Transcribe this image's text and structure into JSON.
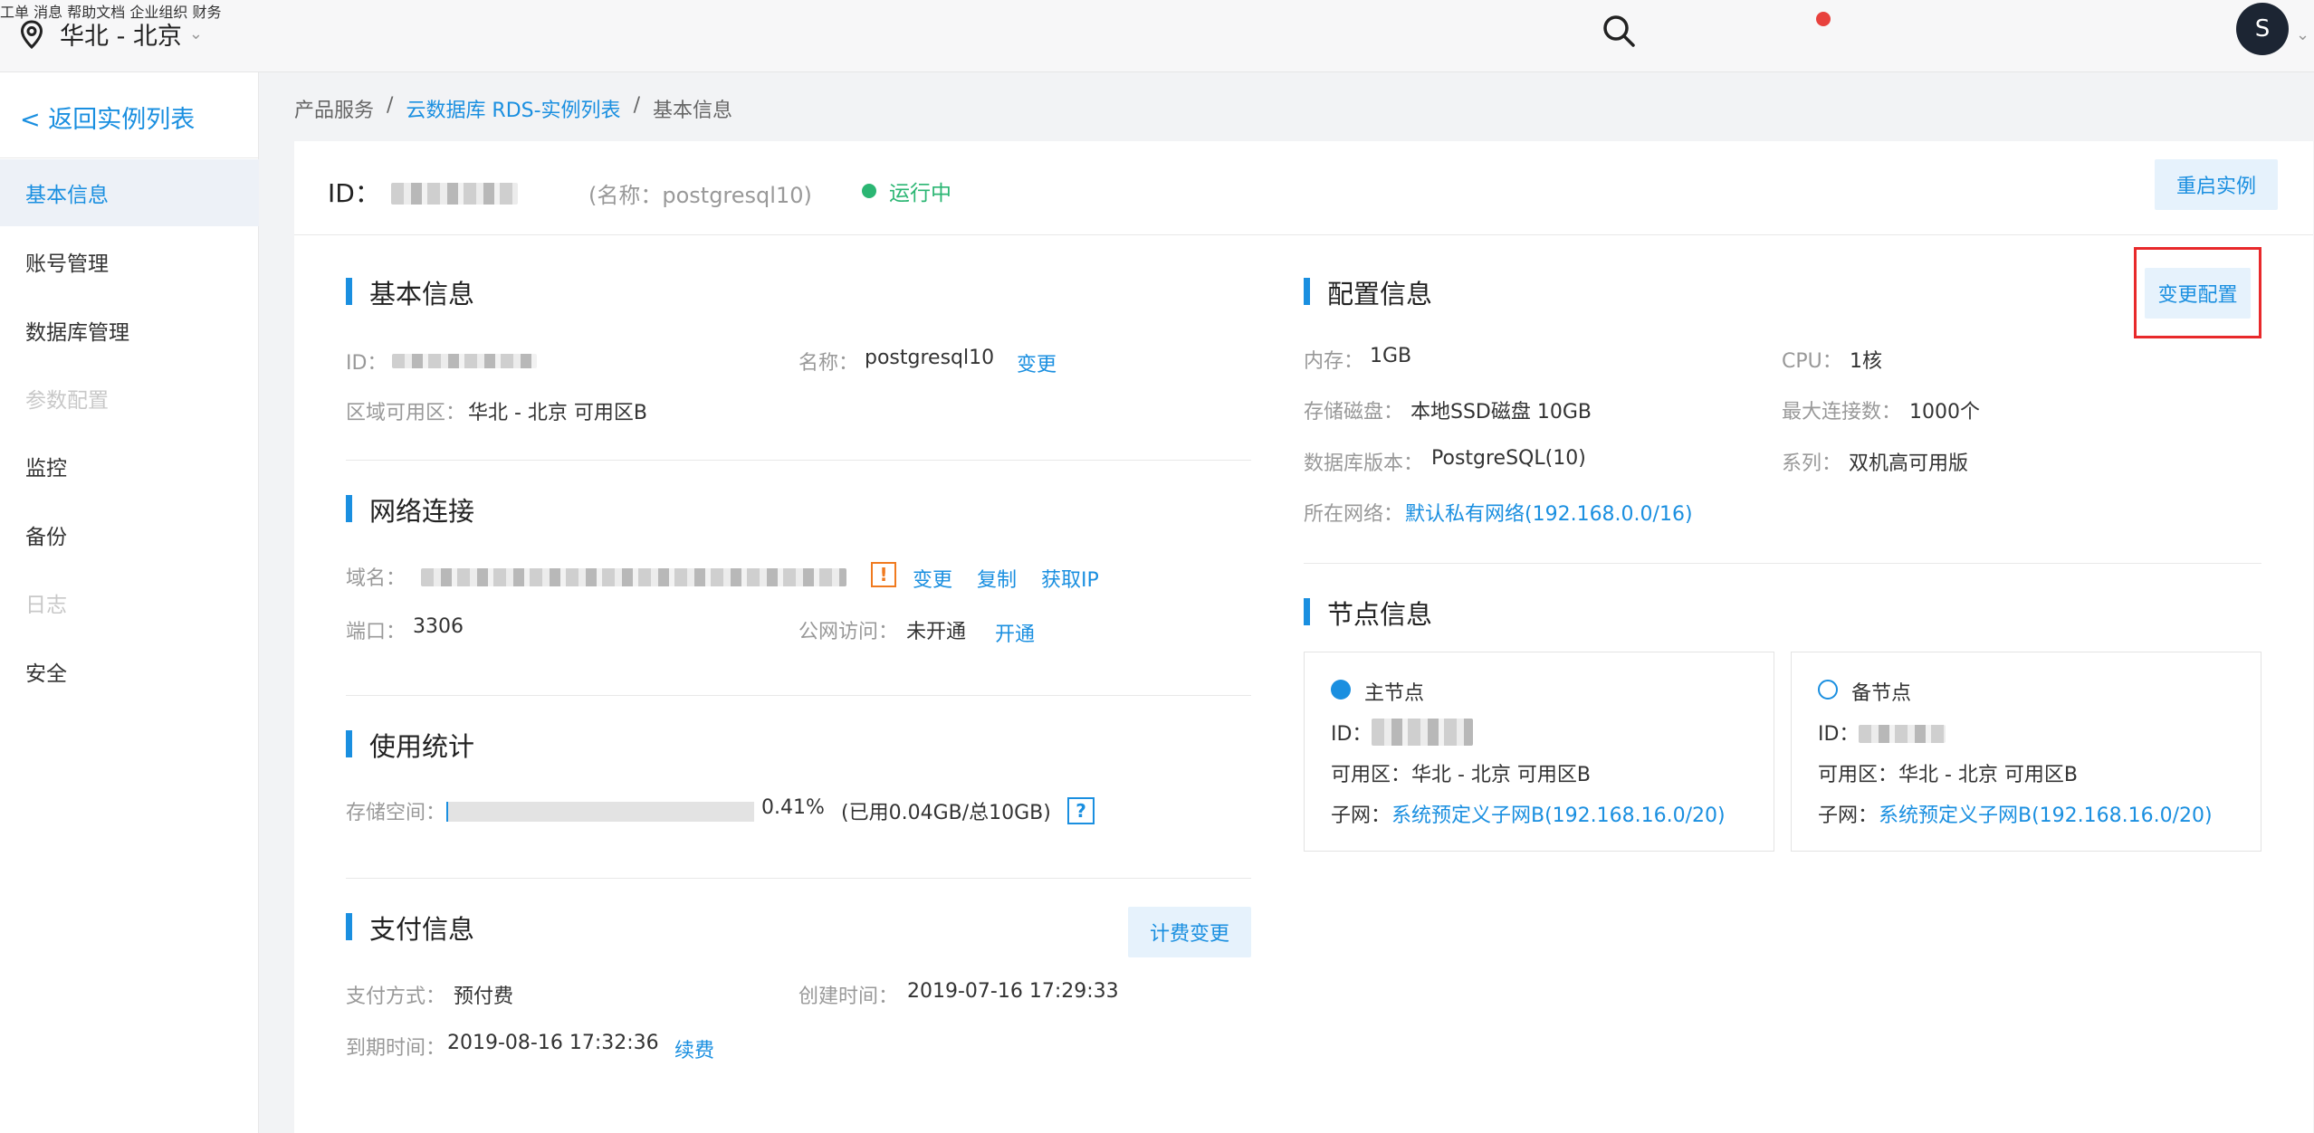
{
  "topbar": {
    "region": "华北 - 北京",
    "nav": {
      "ticket": "工单",
      "messages": "消息",
      "help": "帮助文档",
      "org": "企业组织",
      "finance": "财务"
    },
    "avatar": "S"
  },
  "sidebar": {
    "back": "< 返回实例列表",
    "items": [
      {
        "label": "基本信息"
      },
      {
        "label": "账号管理"
      },
      {
        "label": "数据库管理"
      },
      {
        "label": "参数配置"
      },
      {
        "label": "监控"
      },
      {
        "label": "备份"
      },
      {
        "label": "日志"
      },
      {
        "label": "安全"
      }
    ]
  },
  "breadcrumb": {
    "root": "产品服务",
    "sep": "/",
    "list": "云数据库 RDS-实例列表",
    "current": "基本信息"
  },
  "instance": {
    "id_label": "ID：",
    "name_hint": "(名称：postgresql10)",
    "status": "运行中",
    "restart": "重启实例"
  },
  "basic": {
    "title": "基本信息",
    "id_label": "ID：",
    "name_label": "名称：",
    "name_value": "postgresql10",
    "change": "变更",
    "zone_label": "区域可用区：",
    "zone_value": "华北 - 北京 可用区B"
  },
  "network": {
    "title": "网络连接",
    "domain_label": "域名：",
    "warn": "!",
    "change": "变更",
    "copy": "复制",
    "get_ip": "获取IP",
    "port_label": "端口：",
    "port_value": "3306",
    "public_label": "公网访问：",
    "public_value": "未开通",
    "open": "开通"
  },
  "usage": {
    "title": "使用统计",
    "storage_label": "存储空间：",
    "percent": "0.41%",
    "detail": "(已用0.04GB/总10GB)",
    "help": "?",
    "fraction": 0.0041
  },
  "payment": {
    "title": "支付信息",
    "change_billing": "计费变更",
    "method_label": "支付方式：",
    "method_value": "预付费",
    "created_label": "创建时间：",
    "created_value": "2019-07-16 17:29:33",
    "expire_label": "到期时间：",
    "expire_value": "2019-08-16 17:32:36",
    "renew": "续费"
  },
  "config": {
    "title": "配置信息",
    "change_config": "变更配置",
    "memory_label": "内存：",
    "memory_value": "1GB",
    "cpu_label": "CPU：",
    "cpu_value": "1核",
    "disk_label": "存储磁盘：",
    "disk_value": "本地SSD磁盘 10GB",
    "maxconn_label": "最大连接数：",
    "maxconn_value": "1000个",
    "version_label": "数据库版本：",
    "version_value": "PostgreSQL(10)",
    "series_label": "系列：",
    "series_value": "双机高可用版",
    "network_label": "所在网络：",
    "network_value": "默认私有网络(192.168.0.0/16)"
  },
  "nodes": {
    "title": "节点信息",
    "primary": {
      "title": "主节点",
      "id_label": "ID：",
      "zone_label": "可用区：",
      "zone_value": "华北 - 北京 可用区B",
      "subnet_label": "子网：",
      "subnet_value": "系统预定义子网B(192.168.16.0/20)"
    },
    "standby": {
      "title": "备节点",
      "id_label": "ID：",
      "zone_label": "可用区：",
      "zone_value": "华北 - 北京 可用区B",
      "subnet_label": "子网：",
      "subnet_value": "系统预定义子网B(192.168.16.0/20)"
    }
  }
}
